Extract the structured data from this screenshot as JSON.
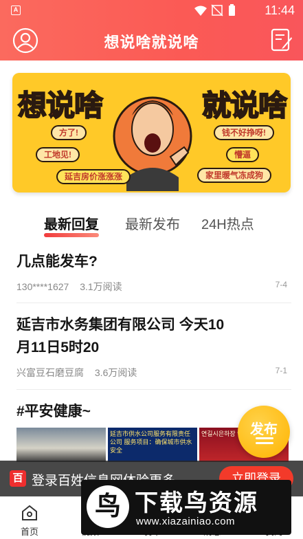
{
  "status_bar": {
    "time": "11:44",
    "app_badge": "A"
  },
  "app_bar": {
    "title": "想说啥就说啥",
    "avatar_icon": "user-circle-icon",
    "edit_icon": "edit-note-icon"
  },
  "banner": {
    "left_big": "想说啥",
    "right_big": "就说啥",
    "pills_left": [
      "方了!",
      "工地见!",
      "延吉房价涨涨涨"
    ],
    "pills_right": [
      "钱不好挣呀!",
      "懵逼",
      "家里暖气冻成狗"
    ]
  },
  "tabs": [
    "最新回复",
    "最新发布",
    "24H热点"
  ],
  "posts": [
    {
      "title": "几点能发车?",
      "author": "130****1627",
      "views": "3.1万阅读",
      "date": "7-4"
    },
    {
      "title": "延吉市水务集团有限公司 今天10月11日5时20",
      "author": "兴富豆石磨豆腐",
      "views": "3.6万阅读",
      "date": "7-1"
    },
    {
      "title": "#平安健康~"
    }
  ],
  "thumbs": {
    "t2_text": "延吉市供水公司服务有限责任公司 服务项目：确保城市供水安全",
    "t3_text": "연길시은하장 안전 공지"
  },
  "fab": {
    "label": "发布"
  },
  "login_bar": {
    "logo": "百",
    "text": "登录百姓信息网体验更多",
    "button": "立即登录"
  },
  "bottom_nav": [
    "首页",
    "视频",
    "发布",
    "消息",
    "我的"
  ],
  "watermark": {
    "title": "下载鸟资源",
    "url": "www.xiazainiao.com",
    "logo": "鸟"
  },
  "colors": {
    "brand_red": "#fb5a55",
    "fab_yellow": "#ffb400",
    "banner_yellow": "#ffc928"
  }
}
